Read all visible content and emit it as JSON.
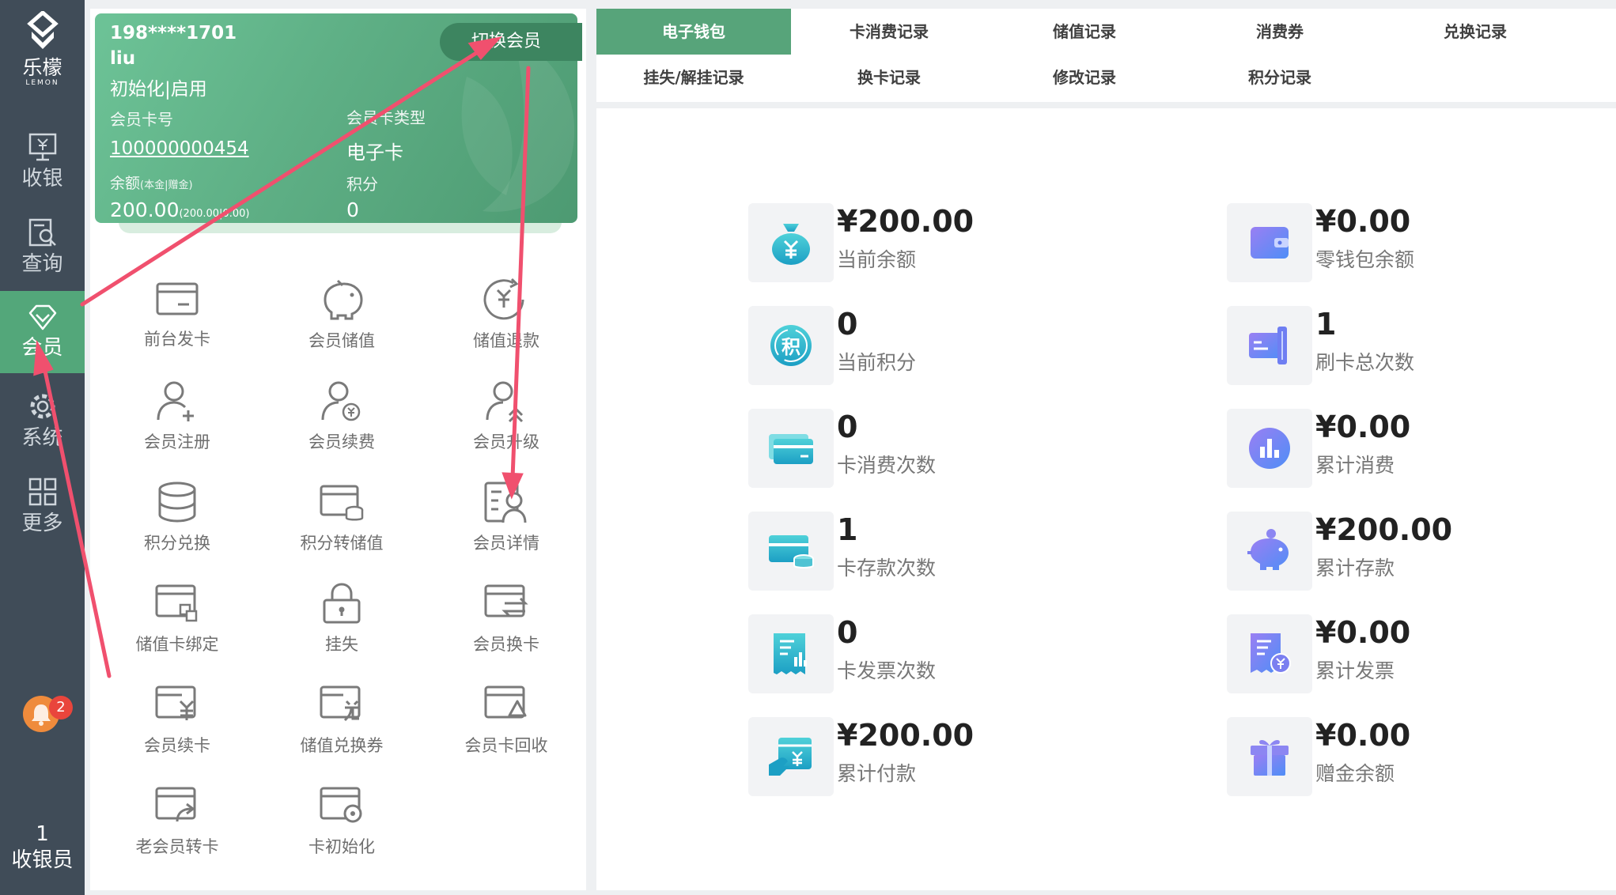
{
  "sidebar": {
    "logo_cn": "乐檬",
    "logo_en": "LEMON",
    "items": [
      {
        "label": "收银",
        "icon": "cash-register-icon"
      },
      {
        "label": "查询",
        "icon": "search-doc-icon"
      },
      {
        "label": "会员",
        "icon": "diamond-icon"
      },
      {
        "label": "系统",
        "icon": "gear-icon"
      },
      {
        "label": "更多",
        "icon": "grid-icon"
      }
    ],
    "notification_count": "2",
    "cashier_number": "1",
    "cashier_label": "收银员"
  },
  "member_card": {
    "phone": "198****1701",
    "name": "liu",
    "status": "初始化|启用",
    "card_no_label": "会员卡号",
    "card_no": "100000000454",
    "card_type_label": "会员卡类型",
    "card_type": "电子卡",
    "balance_label": "余额",
    "balance_sub_label": "(本金|赠金)",
    "balance": "200.00",
    "balance_detail": "(200.00|0.00)",
    "points_label": "积分",
    "points": "0",
    "switch_label": "切换会员"
  },
  "actions": [
    {
      "label": "前台发卡",
      "icon": "card-icon"
    },
    {
      "label": "会员储值",
      "icon": "piggy-bank-icon"
    },
    {
      "label": "储值退款",
      "icon": "refund-icon"
    },
    {
      "label": "会员注册",
      "icon": "user-add-icon"
    },
    {
      "label": "会员续费",
      "icon": "user-renew-icon"
    },
    {
      "label": "会员升级",
      "icon": "user-upgrade-icon"
    },
    {
      "label": "积分兑换",
      "icon": "database-icon"
    },
    {
      "label": "积分转储值",
      "icon": "card-coins-icon"
    },
    {
      "label": "会员详情",
      "icon": "user-detail-icon"
    },
    {
      "label": "储值卡绑定",
      "icon": "card-bind-icon"
    },
    {
      "label": "挂失",
      "icon": "lock-icon"
    },
    {
      "label": "会员换卡",
      "icon": "card-swap-icon"
    },
    {
      "label": "会员续卡",
      "icon": "card-yen-icon"
    },
    {
      "label": "储值兑换券",
      "icon": "card-exchange-icon"
    },
    {
      "label": "会员卡回收",
      "icon": "card-recycle-icon"
    },
    {
      "label": "老会员转卡",
      "icon": "card-transfer-icon"
    },
    {
      "label": "卡初始化",
      "icon": "card-reset-icon"
    }
  ],
  "tabs": [
    {
      "label": "电子钱包"
    },
    {
      "label": "卡消费记录"
    },
    {
      "label": "储值记录"
    },
    {
      "label": "消费券"
    },
    {
      "label": "兑换记录"
    },
    {
      "label": "挂失/解挂记录"
    },
    {
      "label": "换卡记录"
    },
    {
      "label": "修改记录"
    },
    {
      "label": "积分记录"
    }
  ],
  "stats": [
    {
      "value": "¥200.00",
      "label": "当前余额",
      "icon": "money-bag-icon"
    },
    {
      "value": "¥0.00",
      "label": "零钱包余额",
      "icon": "wallet-icon"
    },
    {
      "value": "0",
      "label": "当前积分",
      "icon": "points-icon"
    },
    {
      "value": "1",
      "label": "刷卡总次数",
      "icon": "card-swipe-icon"
    },
    {
      "value": "0",
      "label": "卡消费次数",
      "icon": "cards-icon"
    },
    {
      "value": "¥0.00",
      "label": "累计消费",
      "icon": "bar-chart-icon"
    },
    {
      "value": "1",
      "label": "卡存款次数",
      "icon": "card-deposit-icon"
    },
    {
      "value": "¥200.00",
      "label": "累计存款",
      "icon": "piggy-icon"
    },
    {
      "value": "0",
      "label": "卡发票次数",
      "icon": "invoice-icon"
    },
    {
      "value": "¥0.00",
      "label": "累计发票",
      "icon": "invoice-yen-icon"
    },
    {
      "value": "¥200.00",
      "label": "累计付款",
      "icon": "payment-icon"
    },
    {
      "value": "¥0.00",
      "label": "赠金余额",
      "icon": "gift-icon"
    }
  ],
  "colors": {
    "sidebar_bg": "#404c58",
    "accent_green": "#57a47a",
    "arrow_red": "#f0506e",
    "icon_teal": "#2bb5c8",
    "icon_purple": "#7b7ff0"
  }
}
